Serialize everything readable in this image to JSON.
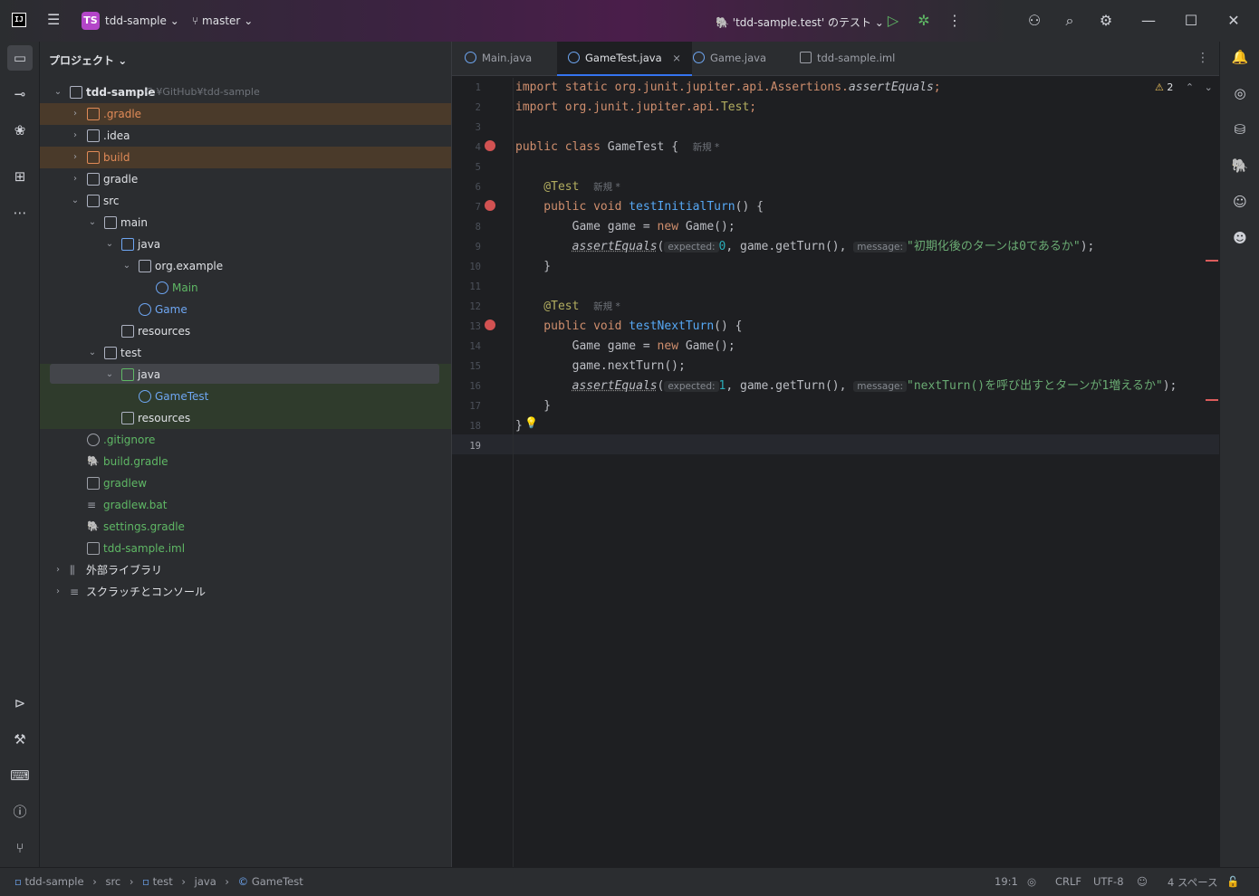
{
  "titlebar": {
    "logo": "IJ",
    "project_badge": "TS",
    "project_name": "tdd-sample",
    "branch": "master",
    "run_config": "'tdd-sample.test' のテスト",
    "icons": [
      "menu-icon",
      "branch-icon",
      "run-icon",
      "debug-icon",
      "more-icon",
      "add-user-icon",
      "search-icon",
      "settings-icon",
      "minimize-icon",
      "maximize-icon",
      "close-icon"
    ]
  },
  "project_panel": {
    "title": "プロジェクト",
    "tree": [
      {
        "label": "tdd-sample",
        "hint": "C:¥GitHub¥tdd-sample",
        "kind": "root"
      },
      {
        "label": ".gradle",
        "kind": "excluded"
      },
      {
        "label": ".idea",
        "kind": "folder"
      },
      {
        "label": "build",
        "kind": "excluded"
      },
      {
        "label": "gradle",
        "kind": "folder"
      },
      {
        "label": "src",
        "kind": "folder"
      },
      {
        "label": "main",
        "kind": "module"
      },
      {
        "label": "java",
        "kind": "source"
      },
      {
        "label": "org.example",
        "kind": "package"
      },
      {
        "label": "Main",
        "kind": "class"
      },
      {
        "label": "Game",
        "kind": "class"
      },
      {
        "label": "resources",
        "kind": "resources"
      },
      {
        "label": "test",
        "kind": "module"
      },
      {
        "label": "java",
        "kind": "test-source"
      },
      {
        "label": "GameTest",
        "kind": "test-class"
      },
      {
        "label": "resources",
        "kind": "test-resources"
      },
      {
        "label": ".gitignore",
        "kind": "file"
      },
      {
        "label": "build.gradle",
        "kind": "file"
      },
      {
        "label": "gradlew",
        "kind": "file"
      },
      {
        "label": "gradlew.bat",
        "kind": "file"
      },
      {
        "label": "settings.gradle",
        "kind": "file"
      },
      {
        "label": "tdd-sample.iml",
        "kind": "file"
      },
      {
        "label": "外部ライブラリ",
        "kind": "library"
      },
      {
        "label": "スクラッチとコンソール",
        "kind": "scratch"
      }
    ]
  },
  "editor": {
    "tabs": [
      {
        "label": "Main.java"
      },
      {
        "label": "GameTest.java",
        "close": "×"
      },
      {
        "label": "Game.java"
      },
      {
        "label": "tdd-sample.iml"
      }
    ],
    "warnings": "2",
    "line_numbers": [
      "1",
      "2",
      "3",
      "4",
      "5",
      "6",
      "7",
      "8",
      "9",
      "10",
      "11",
      "12",
      "13",
      "14",
      "15",
      "16",
      "17",
      "18",
      "19"
    ],
    "code": {
      "l1a": "import static org.junit.jupiter.api.Assertions.",
      "l1b": "assertEquals",
      "l1c": ";",
      "l2a": "import org.junit.jupiter.api.",
      "l2b": "Test",
      "l2c": ";",
      "l4a": "public class ",
      "l4b": "GameTest {",
      "l4c": "新規 *",
      "l6a": "    @Test",
      "l6b": "新規 *",
      "l7a": "    public void ",
      "l7b": "testInitialTurn",
      "l7c": "() {",
      "l8a": "        Game game = ",
      "l8b": "new",
      "l8c": " Game();",
      "l9a": "        ",
      "l9b": "assertEquals",
      "l9c": "(",
      "l9d": "expected:",
      "l9e": "0",
      "l9f": ", game.getTurn(), ",
      "l9g": "message:",
      "l9h": "\"初期化後のターンは0であるか\"",
      "l9i": ");",
      "l10": "    }",
      "l12a": "    @Test",
      "l12b": "新規 *",
      "l13a": "    public void ",
      "l13b": "testNextTurn",
      "l13c": "() {",
      "l14a": "        Game game = ",
      "l14b": "new",
      "l14c": " Game();",
      "l15": "        game.nextTurn();",
      "l16a": "        ",
      "l16b": "assertEquals",
      "l16c": "(",
      "l16d": "expected:",
      "l16e": "1",
      "l16f": ", game.getTurn(), ",
      "l16g": "message:",
      "l16h": "\"nextTurn()を呼び出すとターンが1増えるか\"",
      "l16i": ");",
      "l17": "    }",
      "l18": "}"
    }
  },
  "statusbar": {
    "breadcrumb": [
      "tdd-sample",
      "src",
      "test",
      "java",
      "GameTest"
    ],
    "position": "19:1",
    "line_sep": "CRLF",
    "encoding": "UTF-8",
    "indent": "4 スペース"
  },
  "colors": {
    "accent": "#3574f0",
    "excluded_bg": "#4a3a2a",
    "test_bg": "#2f3b2c",
    "keyword": "#cf8e6d",
    "function": "#56a8f5",
    "string": "#6aab73"
  }
}
